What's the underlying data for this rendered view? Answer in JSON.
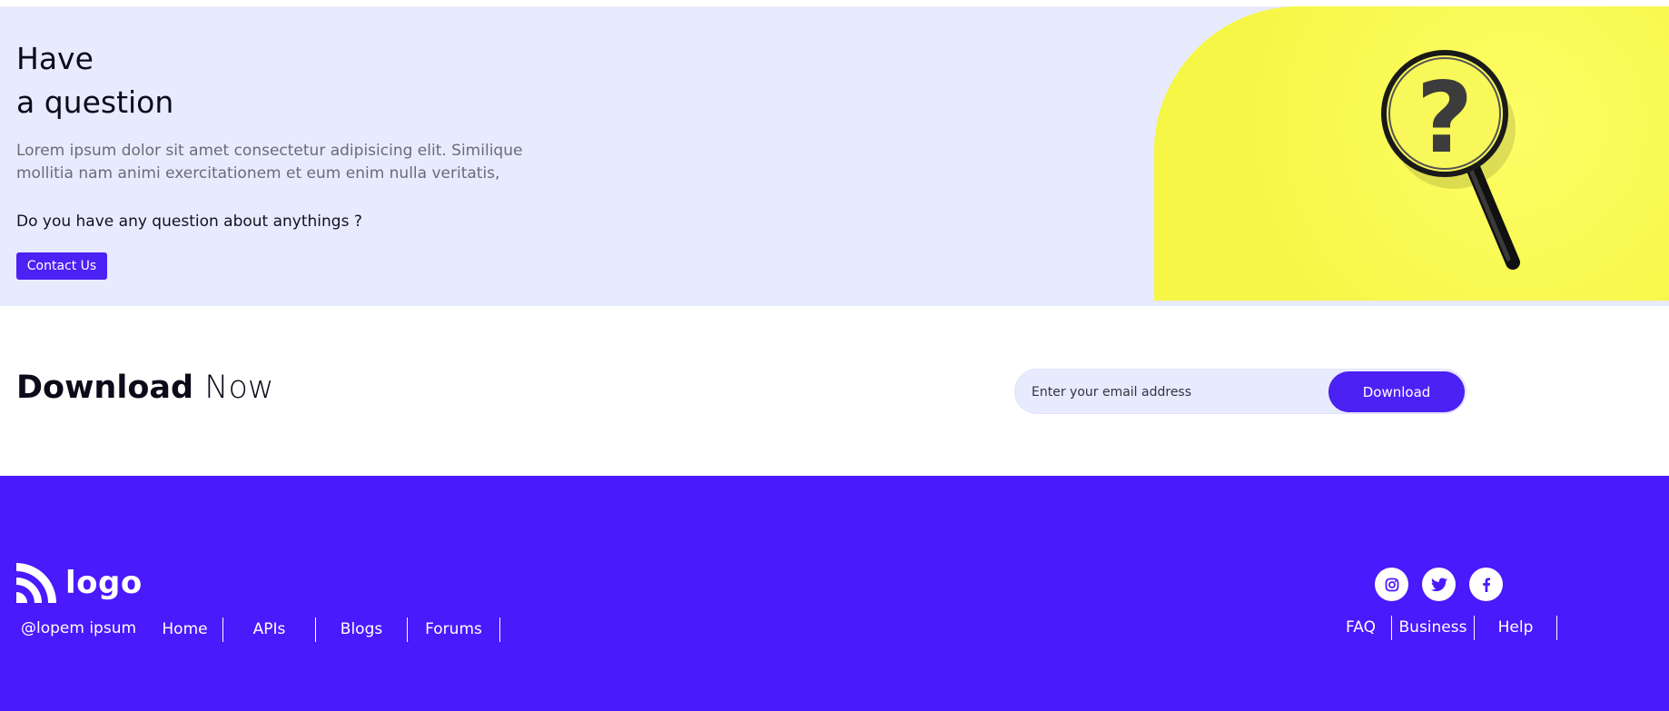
{
  "question": {
    "title_line1": "Have",
    "title_line2": "a question",
    "description": "Lorem ipsum dolor sit amet consectetur adipisicing elit. Similique mollitia nam animi exercitationem et eum enim nulla veritatis,",
    "ask": "Do you have any question about anythings ?",
    "contact_label": "Contact Us"
  },
  "download": {
    "title_bold": "Download",
    "title_light": "Now",
    "email_placeholder": "Enter your email address",
    "button_label": "Download"
  },
  "footer": {
    "logo_text": "logo",
    "copyright": "@lopem ipsum",
    "nav_left": [
      "Home",
      "APIs",
      "Blogs",
      "Forums"
    ],
    "social_icons": [
      "instagram-icon",
      "twitter-icon",
      "facebook-icon"
    ],
    "nav_right": [
      "FAQ",
      "Business",
      "Help"
    ]
  },
  "colors": {
    "accent": "#4c21f4",
    "footer_bg": "#4a19fc",
    "hero_bg": "#e8ebfd",
    "image_yellow": "#fafa52"
  }
}
